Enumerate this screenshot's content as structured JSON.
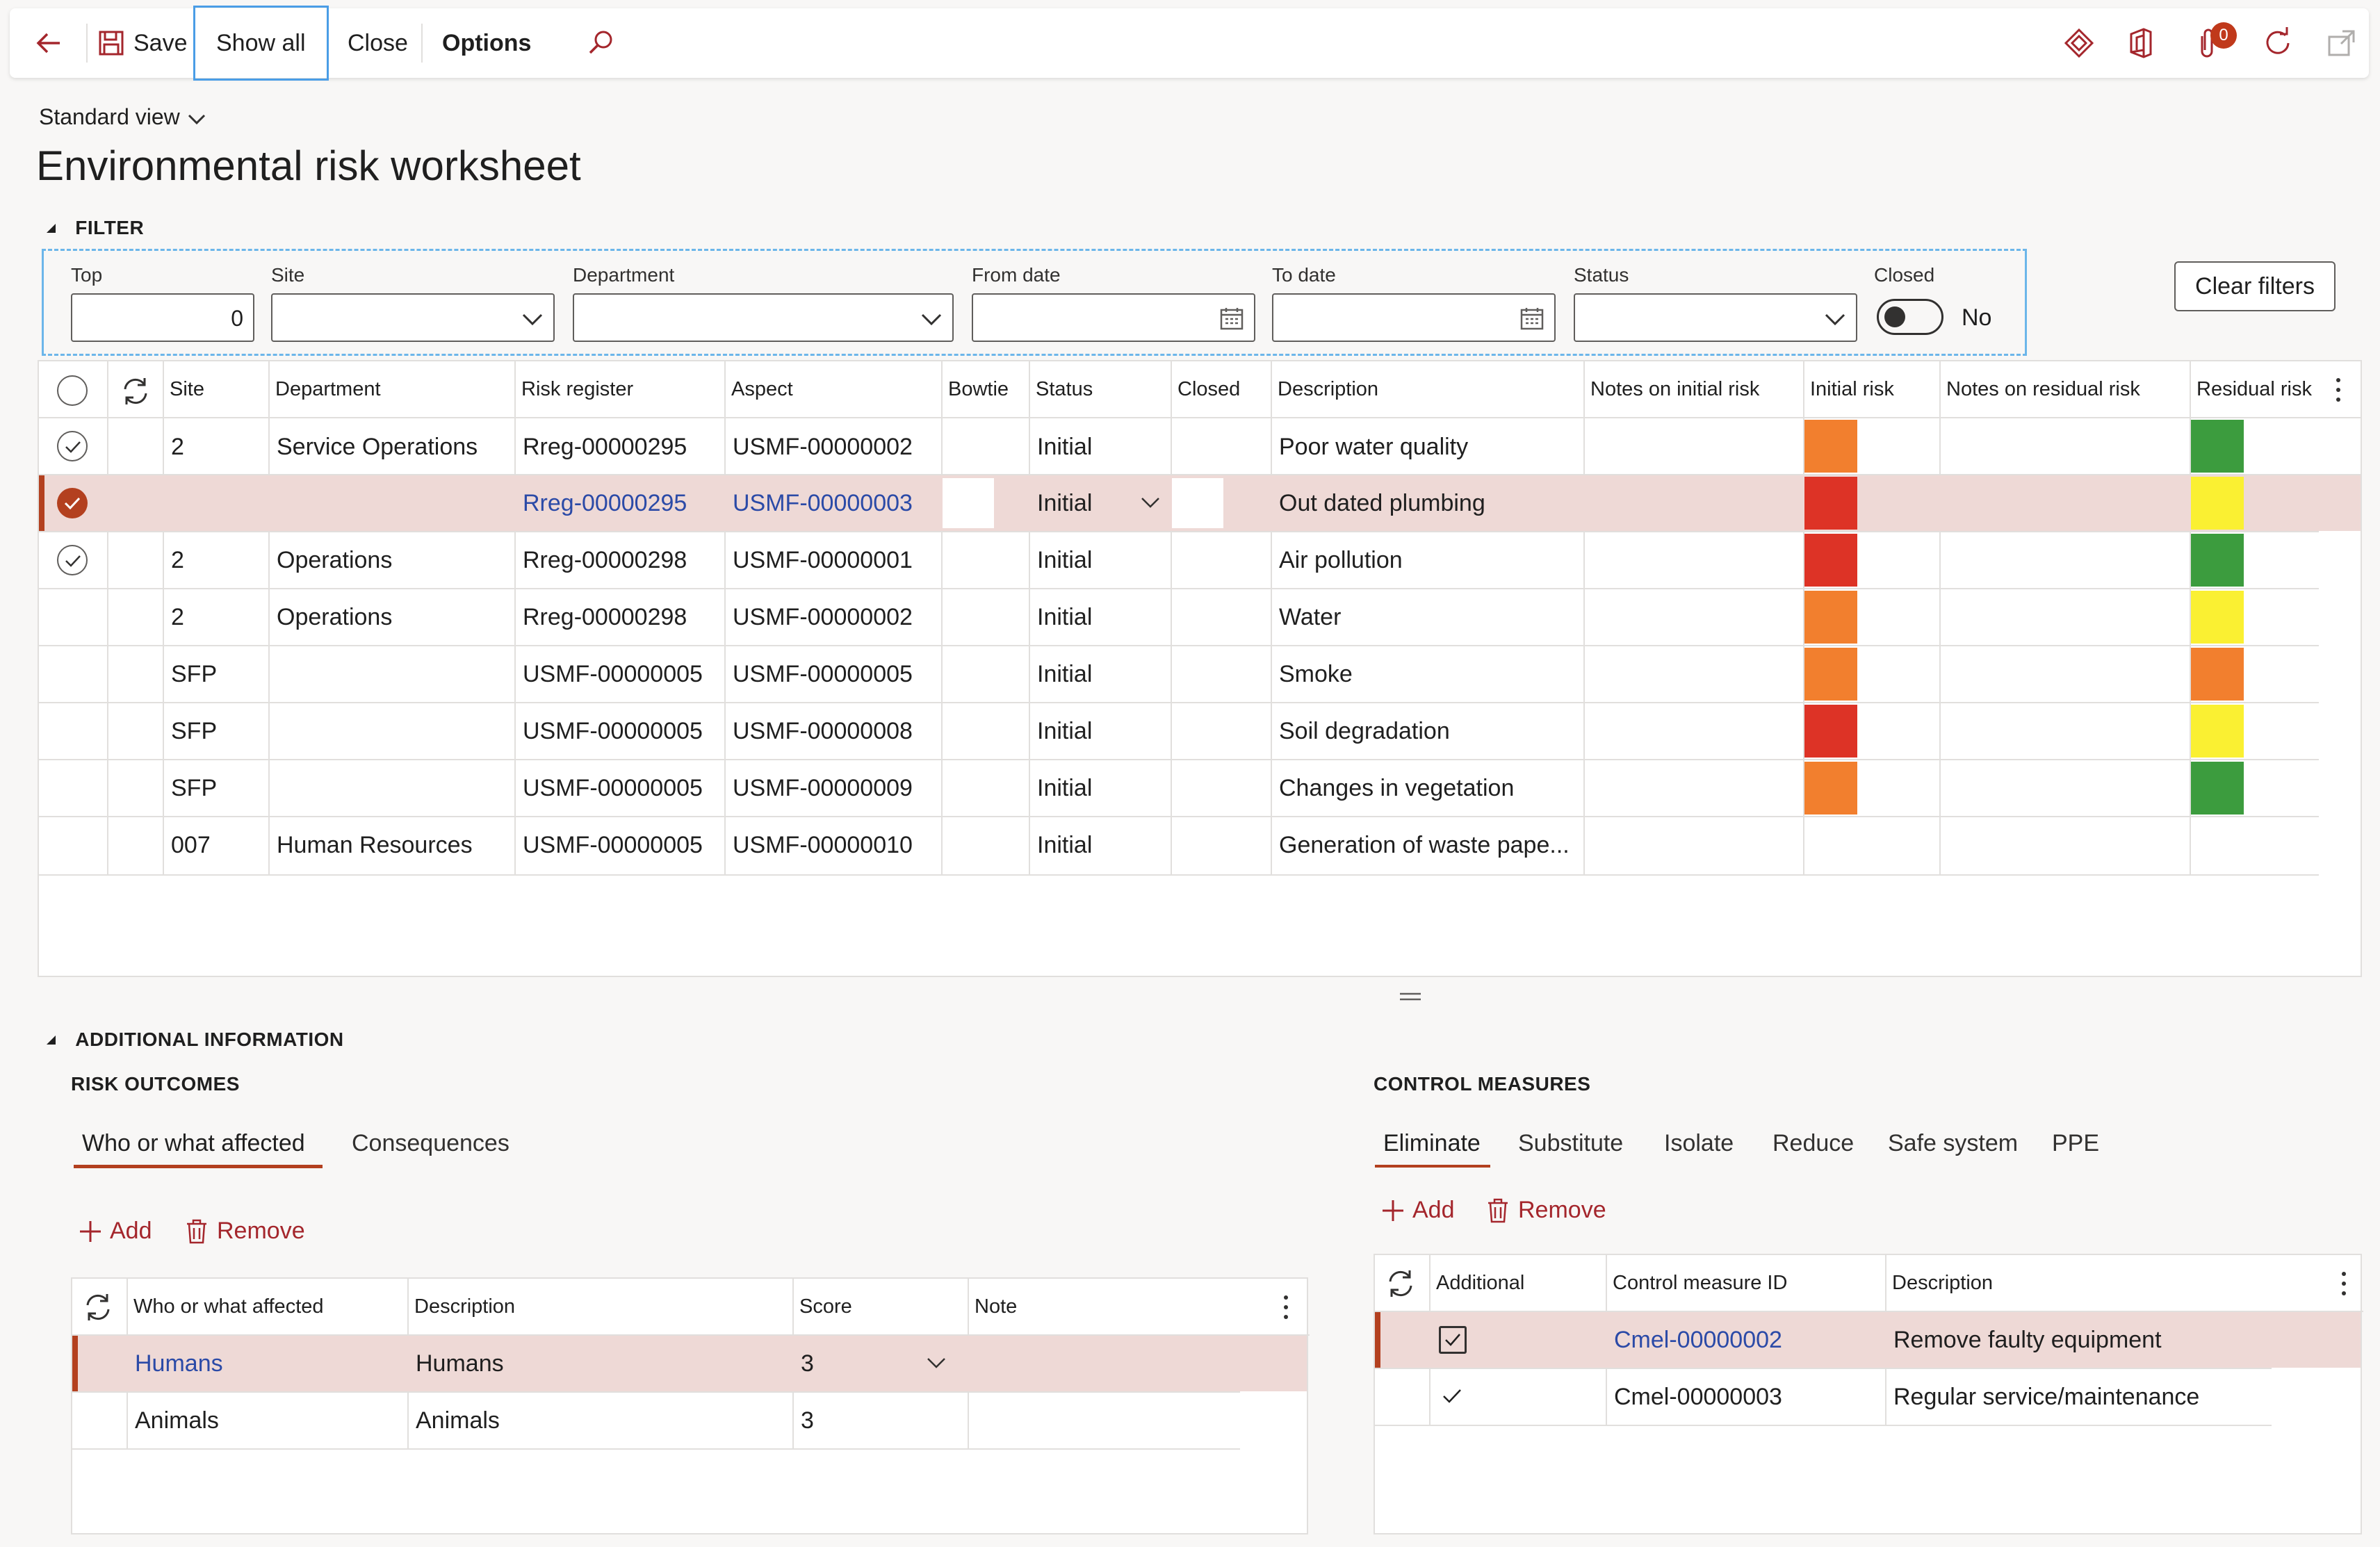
{
  "toolbar": {
    "save": "Save",
    "show_all": "Show all",
    "close": "Close",
    "options": "Options",
    "notification_count": "0"
  },
  "view": {
    "name": "Standard view"
  },
  "page": {
    "title": "Environmental risk worksheet"
  },
  "filter": {
    "section_title": "FILTER",
    "labels": {
      "top": "Top",
      "site": "Site",
      "department": "Department",
      "from_date": "From date",
      "to_date": "To date",
      "status": "Status",
      "closed": "Closed"
    },
    "values": {
      "top": "0",
      "closed": "No"
    },
    "clear_button": "Clear filters"
  },
  "grid": {
    "columns": [
      "Site",
      "Department",
      "Risk register",
      "Aspect",
      "Bowtie",
      "Status",
      "Closed",
      "Description",
      "Notes on initial risk",
      "Initial risk",
      "Notes on residual risk",
      "Residual risk"
    ],
    "rows": [
      {
        "site": "2",
        "department": "Service Operations",
        "risk_register": "Rreg-00000295",
        "aspect": "USMF-00000002",
        "status": "Initial",
        "description": "Poor water quality",
        "initial_risk_color": "#f27f2e",
        "residual_risk_color": "#3c9c3e",
        "checked": true,
        "selected": false
      },
      {
        "site": "",
        "department": "",
        "risk_register": "Rreg-00000295",
        "aspect": "USMF-00000003",
        "status": "Initial",
        "description": "Out dated plumbing",
        "initial_risk_color": "#dd3326",
        "residual_risk_color": "#faf032",
        "checked": true,
        "selected": true
      },
      {
        "site": "2",
        "department": "Operations",
        "risk_register": "Rreg-00000298",
        "aspect": "USMF-00000001",
        "status": "Initial",
        "description": "Air pollution",
        "initial_risk_color": "#dd3326",
        "residual_risk_color": "#3c9c3e",
        "checked": true,
        "selected": false
      },
      {
        "site": "2",
        "department": "Operations",
        "risk_register": "Rreg-00000298",
        "aspect": "USMF-00000002",
        "status": "Initial",
        "description": "Water",
        "initial_risk_color": "#f27f2e",
        "residual_risk_color": "#faf032",
        "checked": false,
        "selected": false
      },
      {
        "site": "SFP",
        "department": "",
        "risk_register": "USMF-00000005",
        "aspect": "USMF-00000005",
        "status": "Initial",
        "description": "Smoke",
        "initial_risk_color": "#f27f2e",
        "residual_risk_color": "#f27f2e",
        "checked": false,
        "selected": false
      },
      {
        "site": "SFP",
        "department": "",
        "risk_register": "USMF-00000005",
        "aspect": "USMF-00000008",
        "status": "Initial",
        "description": "Soil degradation",
        "initial_risk_color": "#dd3326",
        "residual_risk_color": "#faf032",
        "checked": false,
        "selected": false
      },
      {
        "site": "SFP",
        "department": "",
        "risk_register": "USMF-00000005",
        "aspect": "USMF-00000009",
        "status": "Initial",
        "description": "Changes in vegetation",
        "initial_risk_color": "#f27f2e",
        "residual_risk_color": "#3c9c3e",
        "checked": false,
        "selected": false
      },
      {
        "site": "007",
        "department": "Human Resources",
        "risk_register": "USMF-00000005",
        "aspect": "USMF-00000010",
        "status": "Initial",
        "description": "Generation of waste pape...",
        "initial_risk_color": "",
        "residual_risk_color": "",
        "checked": false,
        "selected": false
      }
    ]
  },
  "additional": {
    "section_title": "ADDITIONAL INFORMATION",
    "risk_outcomes": {
      "title": "RISK OUTCOMES",
      "tabs": [
        "Who or what affected",
        "Consequences"
      ],
      "add": "Add",
      "remove": "Remove",
      "columns": [
        "Who or what affected",
        "Description",
        "Score",
        "Note"
      ],
      "rows": [
        {
          "who": "Humans",
          "description": "Humans",
          "score": "3",
          "note": ""
        },
        {
          "who": "Animals",
          "description": "Animals",
          "score": "3",
          "note": ""
        }
      ]
    },
    "control_measures": {
      "title": "CONTROL MEASURES",
      "tabs": [
        "Eliminate",
        "Substitute",
        "Isolate",
        "Reduce",
        "Safe system",
        "PPE"
      ],
      "add": "Add",
      "remove": "Remove",
      "columns": [
        "Additional",
        "Control measure ID",
        "Description"
      ],
      "rows": [
        {
          "id": "Cmel-00000002",
          "description": "Remove faulty equipment",
          "additional": true
        },
        {
          "id": "Cmel-00000003",
          "description": "Regular service/maintenance",
          "additional": true
        }
      ]
    }
  },
  "colors": {
    "accent": "#b3401f",
    "link": "#2b4aa7",
    "selection": "#eed9d6"
  }
}
